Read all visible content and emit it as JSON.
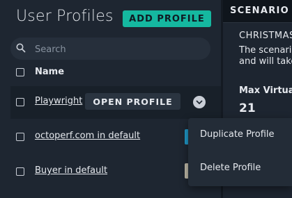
{
  "left": {
    "title": "User Profiles",
    "add_button": "ADD PROFILE",
    "search_placeholder": "Search",
    "column_header": "Name",
    "rows": [
      {
        "name": "Playwright"
      },
      {
        "name": "octoperf.com in default"
      },
      {
        "name": "Buyer in default"
      }
    ],
    "open_button": "OPEN PROFILE"
  },
  "menu": {
    "items": [
      {
        "label": "Duplicate Profile"
      },
      {
        "label": "Delete Profile"
      }
    ]
  },
  "right": {
    "header": "SCENARIO C",
    "line1": "CHRISTMAS",
    "line2": "The scenario",
    "line3": "and will take",
    "label": "Max Virtual",
    "value": "21",
    "partial": "C"
  },
  "colors": {
    "accent": "#15b8a0",
    "background": "#1e2631",
    "menu_bg": "#232c37"
  }
}
